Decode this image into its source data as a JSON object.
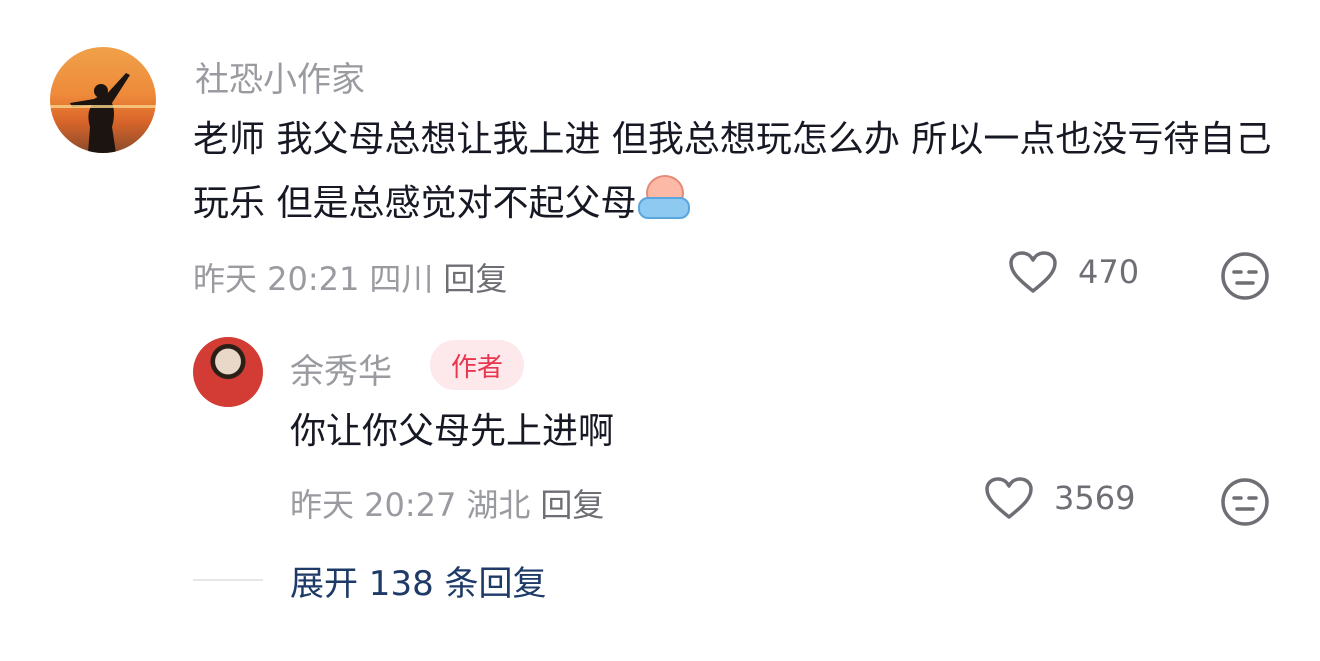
{
  "comments": [
    {
      "username": "社恐小作家",
      "text": "老师 我父母总想让我上进 但我总想玩怎么办 所以一点也没亏待自己玩乐 但是总感觉对不起父母",
      "time": "昨天 20:21",
      "location": "四川",
      "reply_label": "回复",
      "likes": "470",
      "emoji": "crying-face-emoji"
    },
    {
      "username": "余秀华",
      "author_tag": "作者",
      "text": "你让你父母先上进啊",
      "time": "昨天 20:27",
      "location": "湖北",
      "reply_label": "回复",
      "likes": "3569"
    }
  ],
  "expand_label": "展开 138 条回复",
  "colors": {
    "text": "#161823",
    "meta": "#9a9ba0",
    "author_tag_bg": "#fde8ec",
    "author_tag_fg": "#e8364f",
    "expand_link": "#1e3a67"
  }
}
